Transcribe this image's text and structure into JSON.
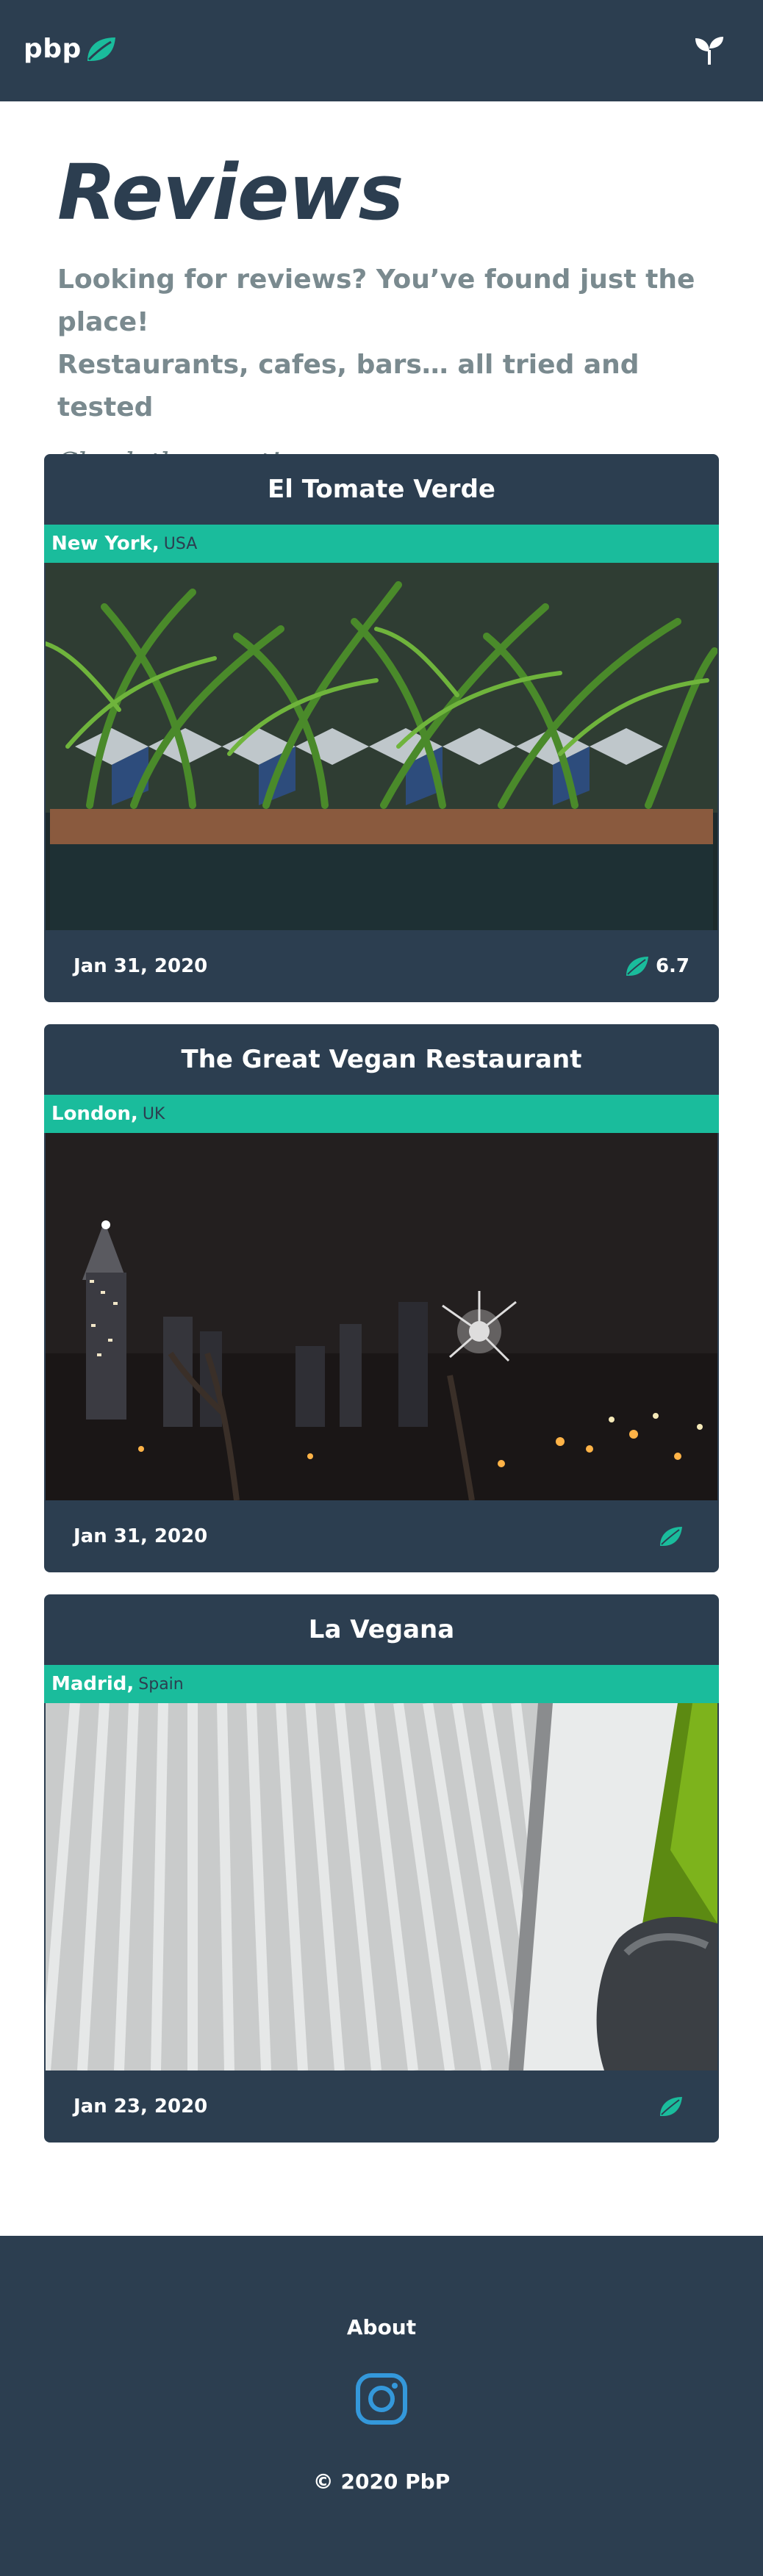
{
  "nav": {
    "brand": "pbp",
    "menu_icon": "sprout-icon"
  },
  "hero": {
    "title": "Reviews",
    "lead_line1": "Looking for reviews? You’ve found just the place!",
    "lead_line2": "Restaurants, cafes, bars… all tried and tested",
    "cta": "Check them out!"
  },
  "reviews": [
    {
      "name": "El Tomate Verde",
      "city": "New York,",
      "country": "USA",
      "date": "Jan 31, 2020",
      "rating": "6.7",
      "image": "plants-photo"
    },
    {
      "name": "The Great Vegan Restaurant",
      "city": "London,",
      "country": "UK",
      "date": "Jan 31, 2020",
      "rating": "",
      "image": "city-fireworks-photo"
    },
    {
      "name": "La Vegana",
      "city": "Madrid,",
      "country": "Spain",
      "date": "Jan 23, 2020",
      "rating": "",
      "image": "blinds-photo"
    }
  ],
  "footer": {
    "about": "About",
    "social_icon": "instagram-icon",
    "copyright": "© 2020 PbP"
  },
  "colors": {
    "navy": "#2c3e50",
    "teal": "#1abc9c",
    "instagram_blue": "#3498db"
  }
}
